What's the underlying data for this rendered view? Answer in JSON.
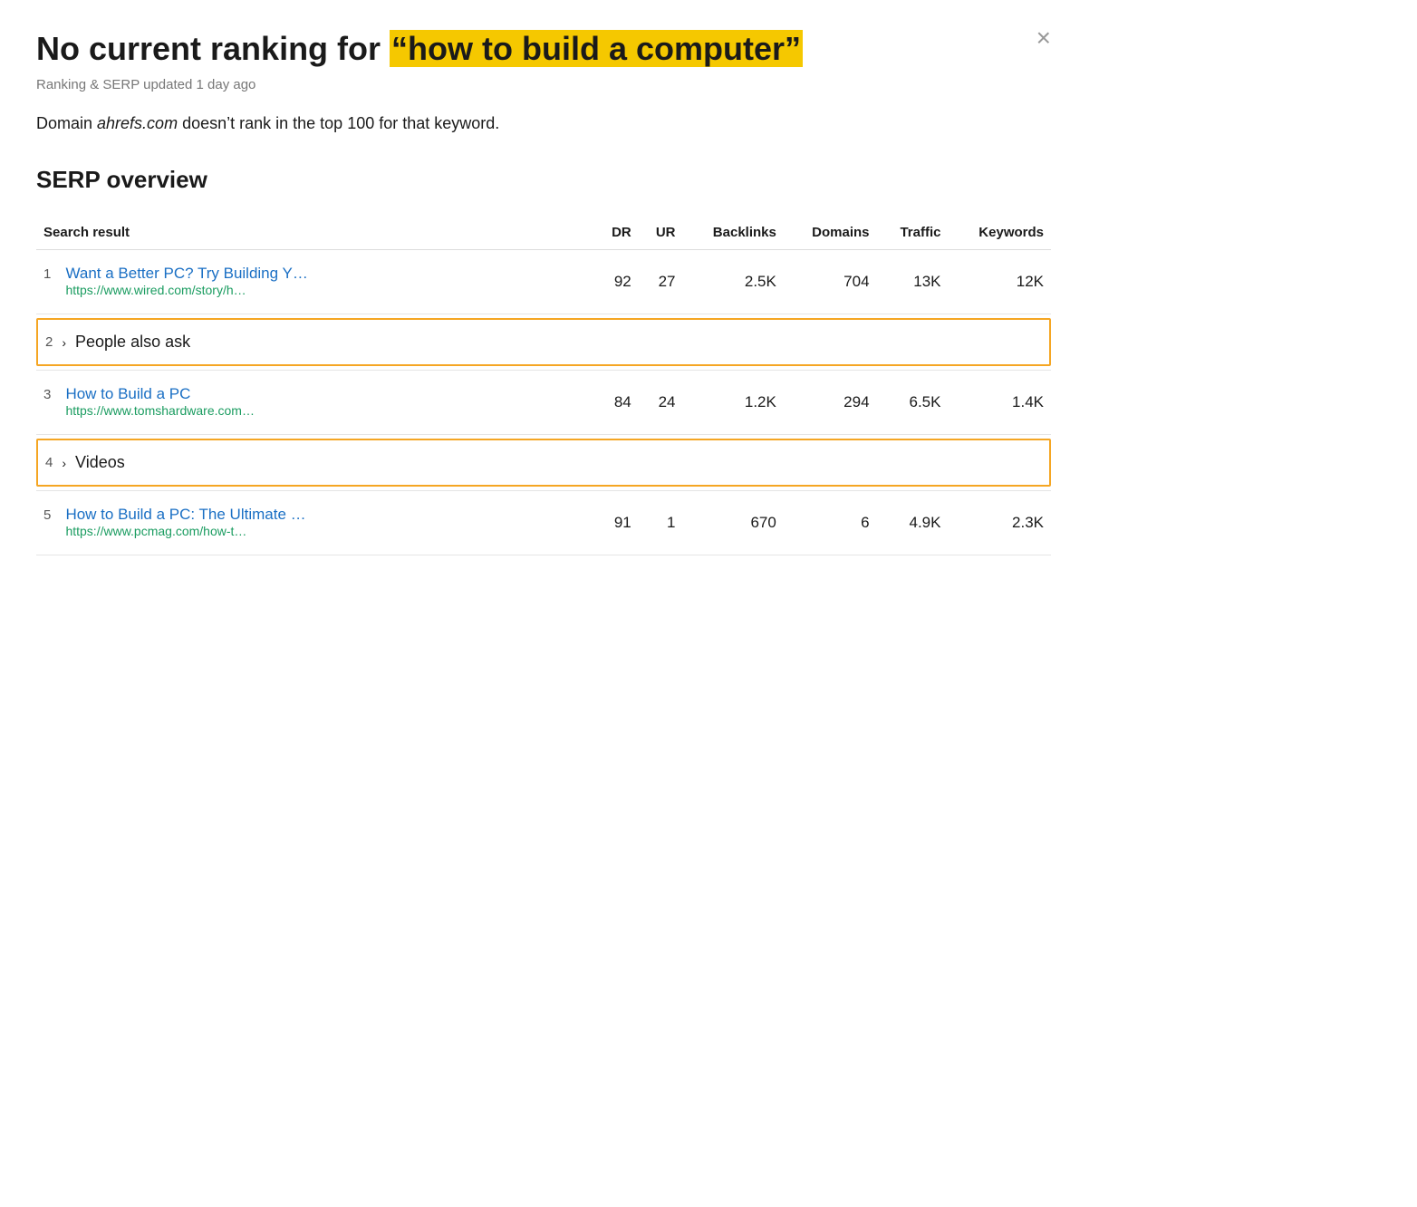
{
  "header": {
    "title_prefix": "No current ranking for ",
    "title_highlight": "“how to build a computer”",
    "subtitle": "Ranking & SERP updated 1 day ago",
    "domain_text_before": "Domain ",
    "domain_name": "ahrefs.com",
    "domain_text_after": " doesn’t rank in the top 100 for that keyword.",
    "close_label": "×"
  },
  "serp": {
    "section_title": "SERP overview",
    "columns": {
      "search_result": "Search result",
      "dr": "DR",
      "ur": "UR",
      "backlinks": "Backlinks",
      "domains": "Domains",
      "traffic": "Traffic",
      "keywords": "Keywords"
    },
    "rows": [
      {
        "type": "result",
        "rank": "1",
        "title": "Want a Better PC? Try Building Y…",
        "url": "https://www.wired.com/story/h…",
        "dr": "92",
        "ur": "27",
        "backlinks": "2.5K",
        "domains": "704",
        "traffic": "13K",
        "keywords": "12K"
      },
      {
        "type": "special",
        "rank": "2",
        "label": "People also ask",
        "chevron": "›"
      },
      {
        "type": "result",
        "rank": "3",
        "title": "How to Build a PC",
        "url": "https://www.tomshardware.com…",
        "dr": "84",
        "ur": "24",
        "backlinks": "1.2K",
        "domains": "294",
        "traffic": "6.5K",
        "keywords": "1.4K"
      },
      {
        "type": "special",
        "rank": "4",
        "label": "Videos",
        "chevron": "›"
      },
      {
        "type": "result",
        "rank": "5",
        "title": "How to Build a PC: The Ultimate …",
        "url": "https://www.pcmag.com/how-t…",
        "dr": "91",
        "ur": "1",
        "backlinks": "670",
        "domains": "6",
        "traffic": "4.9K",
        "keywords": "2.3K"
      }
    ]
  }
}
